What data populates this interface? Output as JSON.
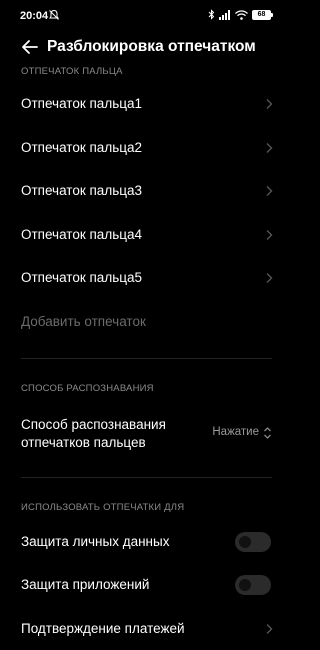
{
  "status_bar": {
    "time": "20:04",
    "battery": "68",
    "icons": [
      "mute-icon",
      "bluetooth-icon",
      "signal-icon",
      "wifi-icon",
      "battery-icon"
    ]
  },
  "header": {
    "title": "Разблокировка отпечатком",
    "back_icon": "arrow-left-icon"
  },
  "fingerprints": {
    "section_label": "ОТПЕЧАТОК ПАЛЬЦА",
    "items": [
      {
        "label": "Отпечаток пальца1"
      },
      {
        "label": "Отпечаток пальца2"
      },
      {
        "label": "Отпечаток пальца3"
      },
      {
        "label": "Отпечаток пальца4"
      },
      {
        "label": "Отпечаток пальца5"
      }
    ],
    "add_label": "Добавить отпечаток"
  },
  "recognition": {
    "section_label": "СПОСОБ РАСПОЗНАВАНИЯ",
    "method_label": "Способ распознавания отпечатков пальцев",
    "method_value": "Нажатие"
  },
  "usage": {
    "section_label": "ИСПОЛЬЗОВАТЬ ОТПЕЧАТКИ ДЛЯ",
    "privacy_label": "Защита личных данных",
    "privacy_enabled": false,
    "apps_label": "Защита приложений",
    "apps_enabled": false,
    "payments_label": "Подтверждение платежей"
  },
  "colors": {
    "background": "#000000",
    "text": "#ffffff",
    "secondary_text": "#8a8a8a",
    "disabled_text": "#6b6b6b",
    "toggle_off": "#2b2b2b"
  }
}
